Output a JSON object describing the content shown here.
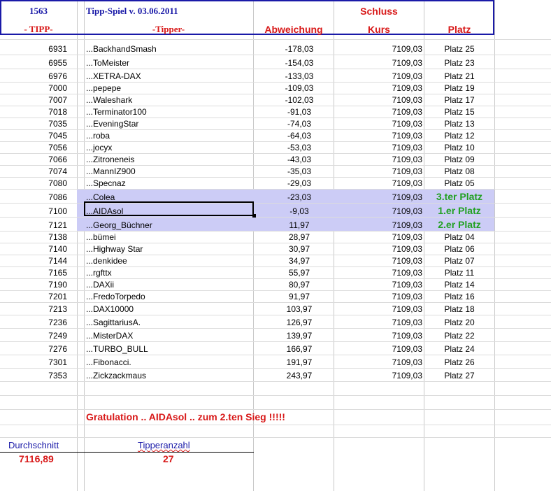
{
  "header": {
    "tip_number": "1563",
    "game_title": "Tipp-Spiel v. 03.06.2011",
    "schluss_label": "Schluss",
    "col_tipp": "- TIPP-",
    "col_tipper": "-Tipper-",
    "col_abweichung": "Abweichung",
    "col_kurs": "Kurs",
    "col_platz": "Platz"
  },
  "rows": [
    {
      "tipp": "6931",
      "tipper": "...BackhandSmash",
      "abw": "-178,03",
      "kurs": "7109,03",
      "platz": "Platz 25"
    },
    {
      "tipp": "6955",
      "tipper": "...ToMeister",
      "abw": "-154,03",
      "kurs": "7109,03",
      "platz": "Platz 23"
    },
    {
      "tipp": "6976",
      "tipper": "...XETRA-DAX",
      "abw": "-133,03",
      "kurs": "7109,03",
      "platz": "Platz 21"
    },
    {
      "tipp": "7000",
      "tipper": "...pepepe",
      "abw": "-109,03",
      "kurs": "7109,03",
      "platz": "Platz 19"
    },
    {
      "tipp": "7007",
      "tipper": "...Waleshark",
      "abw": "-102,03",
      "kurs": "7109,03",
      "platz": "Platz 17"
    },
    {
      "tipp": "7018",
      "tipper": "...Terminator100",
      "abw": "-91,03",
      "kurs": "7109,03",
      "platz": "Platz 15"
    },
    {
      "tipp": "7035",
      "tipper": "...EveningStar",
      "abw": "-74,03",
      "kurs": "7109,03",
      "platz": "Platz 13"
    },
    {
      "tipp": "7045",
      "tipper": "...roba",
      "abw": "-64,03",
      "kurs": "7109,03",
      "platz": "Platz 12"
    },
    {
      "tipp": "7056",
      "tipper": "...jocyx",
      "abw": "-53,03",
      "kurs": "7109,03",
      "platz": "Platz 10"
    },
    {
      "tipp": "7066",
      "tipper": "...Zitroneneis",
      "abw": "-43,03",
      "kurs": "7109,03",
      "platz": "Platz 09"
    },
    {
      "tipp": "7074",
      "tipper": "...MannIZ900",
      "abw": "-35,03",
      "kurs": "7109,03",
      "platz": "Platz 08"
    },
    {
      "tipp": "7080",
      "tipper": "...Specnaz",
      "abw": "-29,03",
      "kurs": "7109,03",
      "platz": "Platz 05"
    },
    {
      "tipp": "7086",
      "tipper": "...Colea",
      "abw": "-23,03",
      "kurs": "7109,03",
      "platz": "3.ter Platz",
      "highlight": true
    },
    {
      "tipp": "7100",
      "tipper": "...AIDAsol",
      "abw": "-9,03",
      "kurs": "7109,03",
      "platz": "1.er Platz",
      "highlight": true
    },
    {
      "tipp": "7121",
      "tipper": "...Georg_Büchner",
      "abw": "11,97",
      "kurs": "7109,03",
      "platz": "2.er Platz",
      "highlight": true
    },
    {
      "tipp": "7138",
      "tipper": "...bümei",
      "abw": "28,97",
      "kurs": "7109,03",
      "platz": "Platz 04"
    },
    {
      "tipp": "7140",
      "tipper": "...Highway Star",
      "abw": "30,97",
      "kurs": "7109,03",
      "platz": "Platz 06"
    },
    {
      "tipp": "7144",
      "tipper": "...denkidee",
      "abw": "34,97",
      "kurs": "7109,03",
      "platz": "Platz 07"
    },
    {
      "tipp": "7165",
      "tipper": "...rgfttx",
      "abw": "55,97",
      "kurs": "7109,03",
      "platz": "Platz 11"
    },
    {
      "tipp": "7190",
      "tipper": "...DAXii",
      "abw": "80,97",
      "kurs": "7109,03",
      "platz": "Platz 14"
    },
    {
      "tipp": "7201",
      "tipper": "...FredoTorpedo",
      "abw": "91,97",
      "kurs": "7109,03",
      "platz": "Platz 16"
    },
    {
      "tipp": "7213",
      "tipper": "...DAX10000",
      "abw": "103,97",
      "kurs": "7109,03",
      "platz": "Platz 18"
    },
    {
      "tipp": "7236",
      "tipper": "...SagittariusA.",
      "abw": "126,97",
      "kurs": "7109,03",
      "platz": "Platz 20"
    },
    {
      "tipp": "7249",
      "tipper": "...MisterDAX",
      "abw": "139,97",
      "kurs": "7109,03",
      "platz": "Platz 22"
    },
    {
      "tipp": "7276",
      "tipper": "...TURBO_BULL",
      "abw": "166,97",
      "kurs": "7109,03",
      "platz": "Platz 24"
    },
    {
      "tipp": "7301",
      "tipper": "...Fibonacci.",
      "abw": "191,97",
      "kurs": "7109,03",
      "platz": "Platz 26"
    },
    {
      "tipp": "7353",
      "tipper": "...Zickzackmaus",
      "abw": "243,97",
      "kurs": "7109,03",
      "platz": "Platz 27"
    }
  ],
  "footer": {
    "congrats": "Gratulation .. AIDAsol .. zum  2.ten Sieg !!!!!",
    "avg_label": "Durchschnitt",
    "avg_value": "7116,89",
    "count_label": "Tipperanzahl",
    "count_value": "27"
  },
  "colors": {
    "header_blue": "#1a1aa8",
    "accent_red": "#d81818",
    "winner_green": "#22a022",
    "highlight_lavender": "#ccccf6"
  }
}
